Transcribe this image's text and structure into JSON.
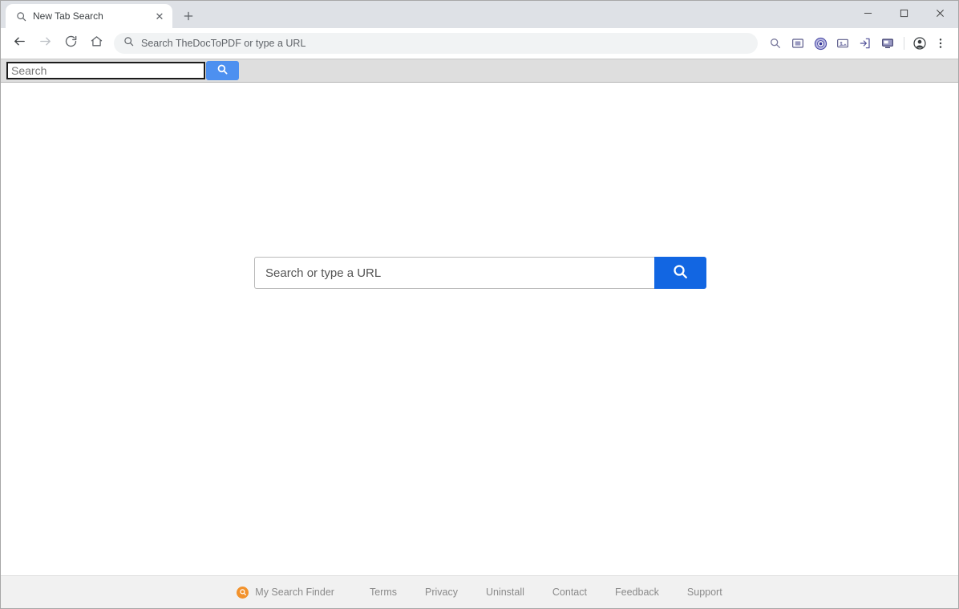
{
  "window": {
    "controls": {
      "minimize": "–",
      "maximize": "☐",
      "close": "✕"
    }
  },
  "tabs": [
    {
      "title": "New Tab Search",
      "favicon": "search-icon",
      "close_label": "✕"
    }
  ],
  "new_tab_label": "+",
  "toolbar": {
    "back_icon": "arrow-left-icon",
    "forward_icon": "arrow-right-icon",
    "reload_icon": "reload-icon",
    "home_icon": "home-icon",
    "omnibox": {
      "placeholder": "Search TheDocToPDF or type a URL",
      "text": "Search TheDocToPDF or type a URL",
      "icon": "search-icon"
    },
    "extensions": [
      {
        "name": "magnifier-extension-icon"
      },
      {
        "name": "screenshot-extension-icon"
      },
      {
        "name": "circle-target-extension-icon"
      },
      {
        "name": "image-card-extension-icon"
      },
      {
        "name": "import-extension-icon"
      },
      {
        "name": "monitor-extension-icon"
      }
    ],
    "profile_icon": "account-circle-icon",
    "menu_icon": "three-dot-menu-icon"
  },
  "extension_bar": {
    "search_value": "Search",
    "search_placeholder": "Search",
    "button_icon": "search-icon",
    "button_color": "#4d90f0"
  },
  "main": {
    "search_placeholder": "Search or type a URL",
    "search_value": "",
    "button_icon": "search-icon",
    "button_color": "#1266e2"
  },
  "footer": {
    "brand": {
      "label": "My Search Finder",
      "icon": "magnifier-badge-icon",
      "icon_color": "#f2922c"
    },
    "links": [
      {
        "label": "Terms"
      },
      {
        "label": "Privacy"
      },
      {
        "label": "Uninstall"
      },
      {
        "label": "Contact"
      },
      {
        "label": "Feedback"
      },
      {
        "label": "Support"
      }
    ]
  }
}
